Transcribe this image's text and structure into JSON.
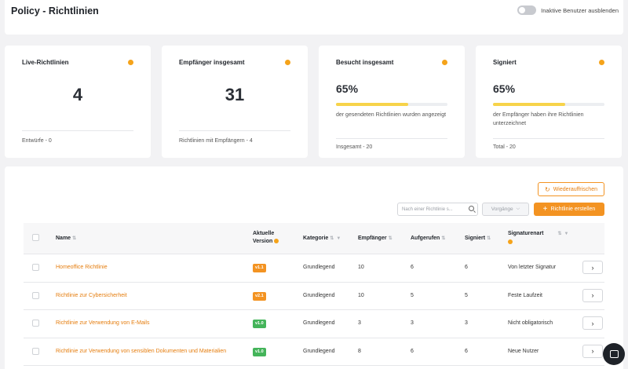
{
  "header": {
    "title": "Policy - Richtlinien",
    "toggle_label": "Inaktive Benutzer ausblenden"
  },
  "stats": [
    {
      "title": "Live-Richtlinien",
      "value": "4",
      "footer": "Entwürfe - 0"
    },
    {
      "title": "Empfänger insgesamt",
      "value": "31",
      "footer": "Richtlinien mit Empfängern - 4"
    },
    {
      "title": "Besucht insgesamt",
      "percent": "65%",
      "progress": 0.65,
      "description": "der gesendeten Richtlinien wurden angezeigt",
      "footer": "Insgesamt - 20"
    },
    {
      "title": "Signiert",
      "percent": "65%",
      "progress": 0.65,
      "description": "der Empfänger haben ihre Richtlinien unterzeichnet",
      "footer": "Total - 20"
    }
  ],
  "toolbar": {
    "refresh_label": "Wiederauffrischen",
    "search_placeholder": "Nach einer Richtlinie s...",
    "select_label": "Vorgänge",
    "create_label": "Richtlinie erstellen"
  },
  "table": {
    "columns": {
      "name": "Name",
      "version_line1": "Aktuelle",
      "version_line2": "Version",
      "category": "Kategorie",
      "recipients": "Empfänger",
      "opened": "Aufgerufen",
      "signed": "Signiert",
      "signature_type": "Signaturenart"
    },
    "rows": [
      {
        "name": "Homeoffice Richtlinie",
        "version": "v1.1",
        "version_color": "orange",
        "category": "Grundlegend",
        "recipients": "10",
        "opened": "6",
        "signed": "6",
        "signature_type": "Von letzter Signatur"
      },
      {
        "name": "Richtlinie zur Cybersicherheit",
        "version": "v2.1",
        "version_color": "orange",
        "category": "Grundlegend",
        "recipients": "10",
        "opened": "5",
        "signed": "5",
        "signature_type": "Feste Laufzeit"
      },
      {
        "name": "Richtlinie zur Verwendung von E-Mails",
        "version": "v1.0",
        "version_color": "green",
        "category": "Grundlegend",
        "recipients": "3",
        "opened": "3",
        "signed": "3",
        "signature_type": "Nicht obligatorisch"
      },
      {
        "name": "Richtlinie zur Verwendung von sensiblen Dokumenten und Materialien",
        "version": "v1.0",
        "version_color": "green",
        "category": "Grundlegend",
        "recipients": "8",
        "opened": "6",
        "signed": "6",
        "signature_type": "Neue Nutzer"
      }
    ]
  },
  "colors": {
    "accent": "#f39322",
    "green": "#44b45a",
    "progress": "#f7d34a"
  },
  "icons": [
    "info-icon",
    "refresh-icon",
    "search-icon",
    "chevron-down-icon",
    "plus-icon",
    "sort-icon",
    "filter-icon",
    "chevron-right-icon",
    "chat-icon"
  ]
}
